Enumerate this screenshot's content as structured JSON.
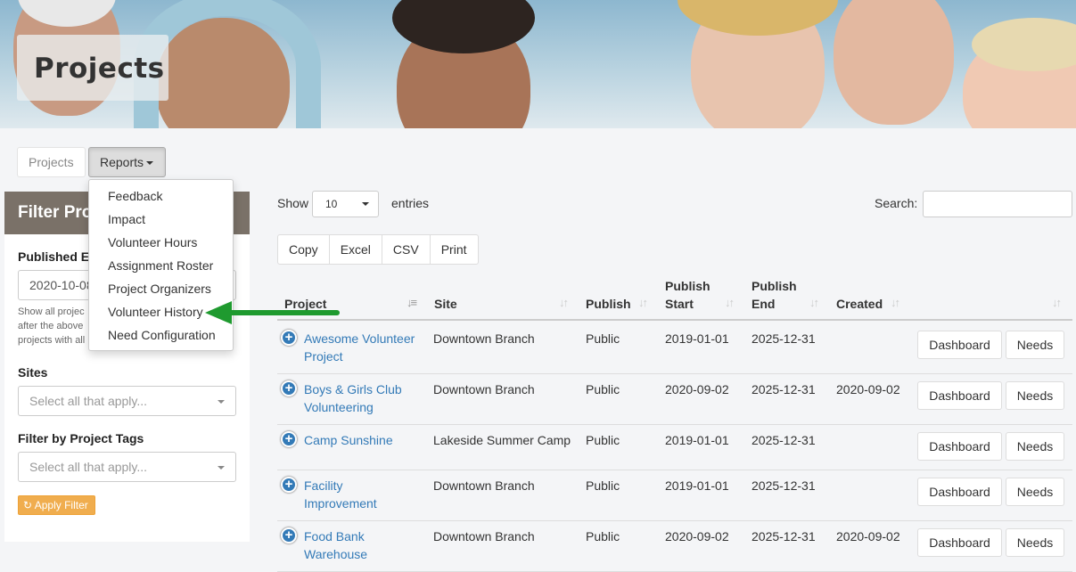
{
  "banner": {
    "title": "Projects"
  },
  "tabs": {
    "projects_label": "Projects",
    "reports_label": "Reports"
  },
  "reports_menu": [
    "Feedback",
    "Impact",
    "Volunteer Hours",
    "Assignment Roster",
    "Project Organizers",
    "Volunteer History",
    "Need Configuration"
  ],
  "sidebar": {
    "heading": "Filter Pro",
    "published_label": "Published E",
    "published_value": "2020-10-08",
    "help_text_lines": [
      "Show all projec",
      "after the above",
      "projects with all"
    ],
    "sites_label": "Sites",
    "sites_placeholder": "Select all that apply...",
    "tags_label": "Filter by Project Tags",
    "tags_placeholder": "Select all that apply...",
    "apply_label": "Apply Filter"
  },
  "table_controls": {
    "show_label": "Show",
    "length_value": "10",
    "entries_label": "entries",
    "search_label": "Search:",
    "export_buttons": [
      "Copy",
      "Excel",
      "CSV",
      "Print"
    ]
  },
  "columns": {
    "project": "Project",
    "site": "Site",
    "publish": "Publish",
    "publish_start_1": "Publish",
    "publish_start_2": "Start",
    "publish_end_1": "Publish",
    "publish_end_2": "End",
    "created": "Created"
  },
  "rows": [
    {
      "project_1": "Awesome Volunteer",
      "project_2": "Project",
      "site": "Downtown Branch",
      "publish": "Public",
      "start": "2019-01-01",
      "end": "2025-12-31",
      "created": "",
      "dashboard": "Dashboard",
      "needs": "Needs"
    },
    {
      "project_1": "Boys & Girls Club",
      "project_2": "Volunteering",
      "site": "Downtown Branch",
      "publish": "Public",
      "start": "2020-09-02",
      "end": "2025-12-31",
      "created": "2020-09-02",
      "dashboard": "Dashboard",
      "needs": "Needs"
    },
    {
      "project_1": "Camp Sunshine",
      "project_2": "",
      "site": "Lakeside Summer Camp",
      "publish": "Public",
      "start": "2019-01-01",
      "end": "2025-12-31",
      "created": "",
      "dashboard": "Dashboard",
      "needs": "Needs"
    },
    {
      "project_1": "Facility",
      "project_2": "Improvement",
      "site": "Downtown Branch",
      "publish": "Public",
      "start": "2019-01-01",
      "end": "2025-12-31",
      "created": "",
      "dashboard": "Dashboard",
      "needs": "Needs"
    },
    {
      "project_1": "Food Bank",
      "project_2": "Warehouse",
      "site": "Downtown Branch",
      "publish": "Public",
      "start": "2020-09-02",
      "end": "2025-12-31",
      "created": "2020-09-02",
      "dashboard": "Dashboard",
      "needs": "Needs"
    }
  ],
  "colors": {
    "link": "#337ab7",
    "sidebar_header": "#7a7168",
    "apply_button": "#f0ad4e",
    "arrow": "#1f9a2f"
  }
}
